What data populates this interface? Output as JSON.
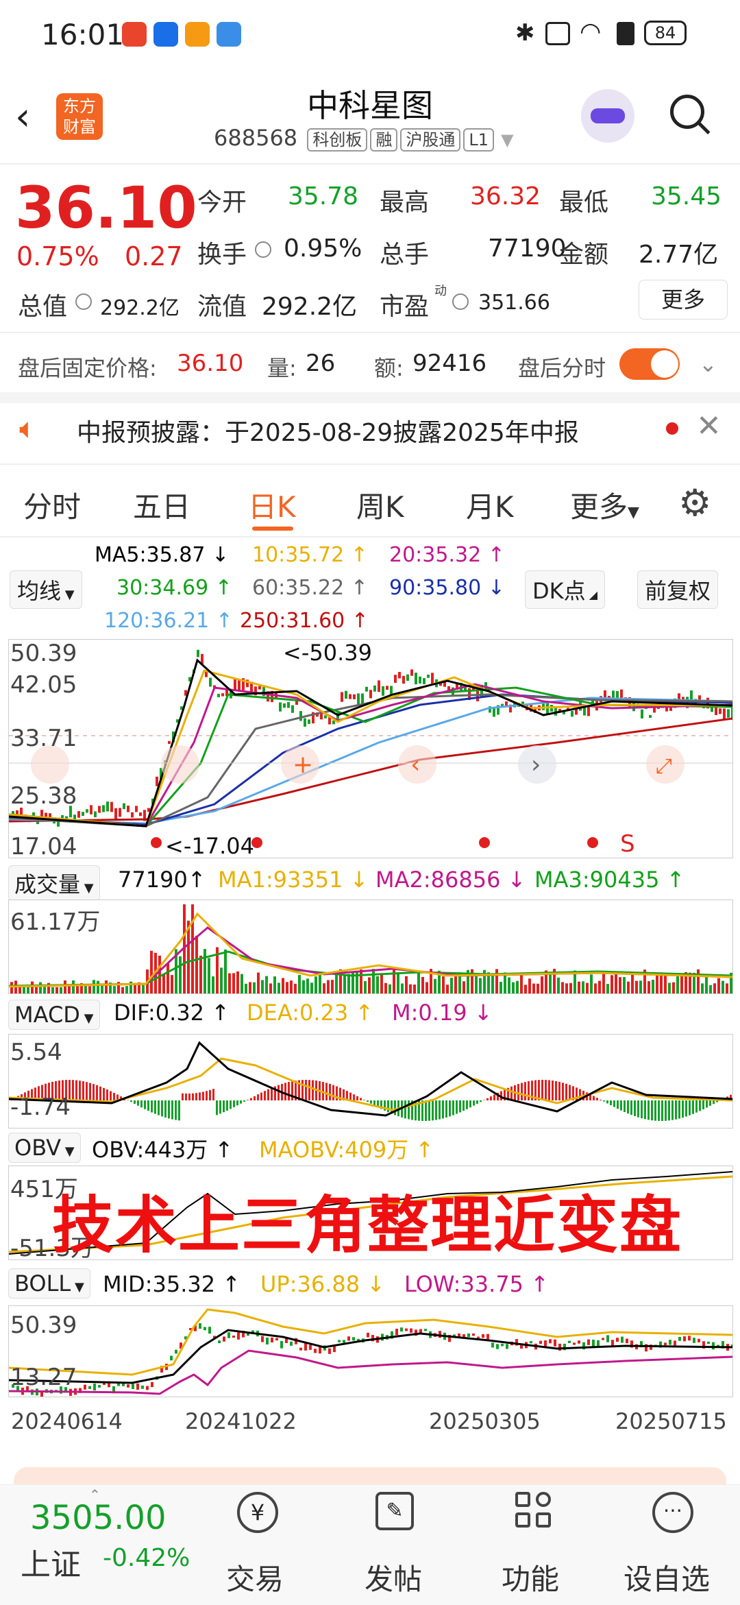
{
  "status": {
    "time": "16:01",
    "battery": "84"
  },
  "header": {
    "stock_name": "中科星图",
    "stock_code": "688568",
    "tags": [
      "科创板",
      "融",
      "沪股通",
      "L1"
    ],
    "logo_text_1": "东方",
    "logo_text_2": "财富"
  },
  "quote": {
    "price": "36.10",
    "change_pct": "0.75%",
    "change_amt": "0.27",
    "open_label": "今开",
    "open": "35.78",
    "high_label": "最高",
    "high": "36.32",
    "low_label": "最低",
    "low": "35.45",
    "turnover_label": "换手",
    "turnover": "0.95%",
    "volume_label": "总手",
    "volume": "77190",
    "amount_label": "金额",
    "amount": "2.77亿",
    "mktcap_label": "总值",
    "mktcap": "292.2亿",
    "float_label": "流值",
    "float_cap": "292.2亿",
    "pe_label": "市盈",
    "pe_sup": "动",
    "pe": "351.66",
    "more": "更多"
  },
  "after_hours": {
    "label": "盘后固定价格:",
    "price": "36.10",
    "qty_label": "量:",
    "qty": "26",
    "amt_label": "额:",
    "amt": "92416",
    "toggle_label": "盘后分时"
  },
  "notice": {
    "text": "中报预披露：于2025-08-29披露2025年中报"
  },
  "tabs": [
    "分时",
    "五日",
    "日K",
    "周K",
    "月K",
    "更多"
  ],
  "active_tab": "日K",
  "ma": {
    "selector": "均线",
    "ma5": "MA5:35.87",
    "ma10": "10:35.72",
    "ma20": "20:35.32",
    "ma30": "30:34.69",
    "ma60": "60:35.22",
    "ma90": "90:35.80",
    "ma120": "120:36.21",
    "ma250": "250:31.60",
    "dk_button": "DK点",
    "adjust_button": "前复权"
  },
  "kline": {
    "y_labels": [
      "50.39",
      "42.05",
      "33.71",
      "25.38",
      "17.04"
    ],
    "max_marker": "<-50.39",
    "min_marker": "<-17.04",
    "s_marker": "S"
  },
  "volume": {
    "selector": "成交量",
    "value": "77190",
    "ma1": "MA1:93351",
    "ma2": "MA2:86856",
    "ma3": "MA3:90435",
    "y_label": "61.17万"
  },
  "macd": {
    "selector": "MACD",
    "dif": "DIF:0.32",
    "dea": "DEA:0.23",
    "m": "M:0.19",
    "y_top": "5.54",
    "y_bot": "-1.74"
  },
  "obv": {
    "selector": "OBV",
    "obv": "OBV:443万",
    "maobv": "MAOBV:409万",
    "y_top": "451万",
    "y_bot": "-51.3万",
    "overlay_text": "技术上三角整理近变盘"
  },
  "boll": {
    "selector": "BOLL",
    "mid": "MID:35.32",
    "up": "UP:36.88",
    "low": "LOW:33.75",
    "y_top": "50.39",
    "y_bot": "13.27"
  },
  "x_dates": [
    "20240614",
    "20241022",
    "20250305",
    "20250715"
  ],
  "bottom": {
    "index_value": "3505.00",
    "index_name": "上证",
    "index_change": "-0.42%",
    "nav": [
      "交易",
      "发帖",
      "功能",
      "设自选"
    ]
  },
  "colors": {
    "up": "#e02020",
    "down": "#14a02a",
    "accent": "#f26522",
    "ma5": "#000000",
    "ma10": "#e8b000",
    "ma20": "#c0188c",
    "ma30": "#12a01a",
    "ma60": "#666666",
    "ma90": "#1a2fa8",
    "ma120": "#5aa8e8",
    "ma250": "#c01010"
  }
}
